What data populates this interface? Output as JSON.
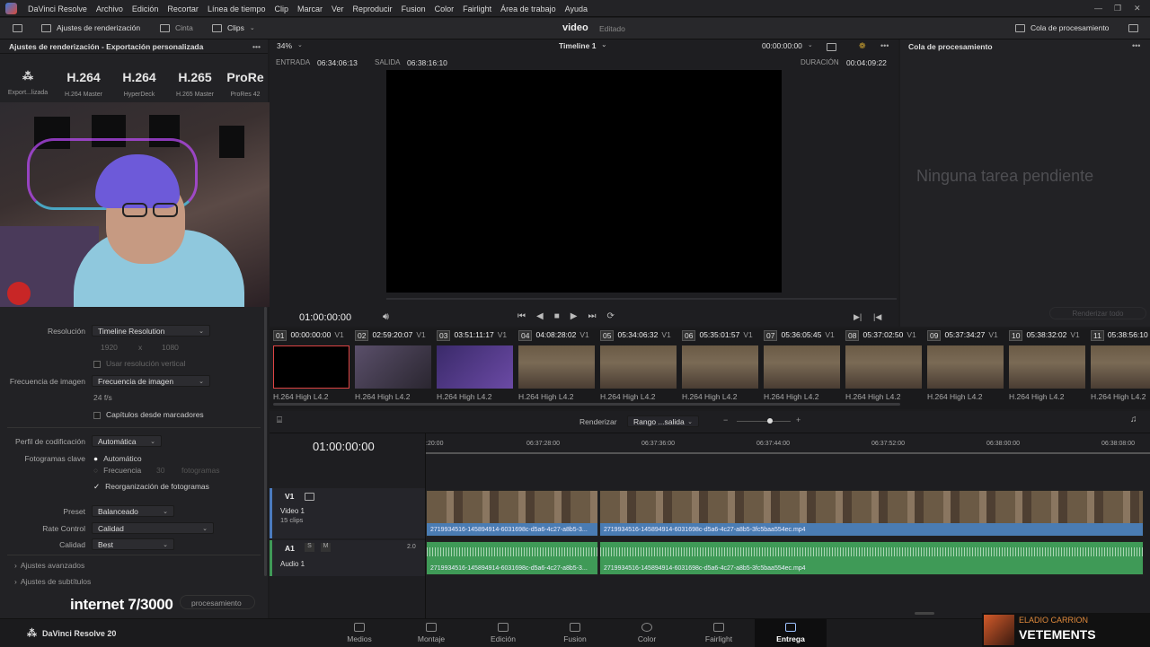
{
  "menubar": {
    "app": "DaVinci Resolve",
    "items": [
      "Archivo",
      "Edición",
      "Recortar",
      "Línea de tiempo",
      "Clip",
      "Marcar",
      "Ver",
      "Reproducir",
      "Fusion",
      "Color",
      "Fairlight",
      "Área de trabajo",
      "Ayuda"
    ]
  },
  "toolbar": {
    "render_settings": "Ajustes de renderización",
    "tape": "Cinta",
    "clips": "Clips",
    "project": "video",
    "state": "Editado",
    "queue_button": "Cola de procesamiento"
  },
  "left": {
    "title": "Ajustes de renderización - Exportación personalizada",
    "presets": [
      {
        "big": "",
        "small": "Export...lizada"
      },
      {
        "big": "H.264",
        "small": "H.264 Master"
      },
      {
        "big": "H.264",
        "small": "HyperDeck"
      },
      {
        "big": "H.265",
        "small": "H.265 Master"
      },
      {
        "big": "ProRe",
        "small": "ProRes 42"
      }
    ],
    "resolution_label": "Resolución",
    "resolution_value": "Timeline Resolution",
    "res_w": "1920",
    "res_x": "x",
    "res_h": "1080",
    "vertical_label": "Usar resolución vertical",
    "framerate_label": "Frecuencia de imagen",
    "framerate_value": "Frecuencia de imagen",
    "fps": "24 f/s",
    "chapters_label": "Capítulos desde marcadores",
    "profile_label": "Perfil de codificación",
    "profile_value": "Automática",
    "keyframes_label": "Fotogramas clave",
    "kf_auto": "Automático",
    "kf_freq": "Frecuencia",
    "kf_freq_val": "30",
    "kf_frames": "fotogramas",
    "reorder_label": "Reorganización de fotogramas",
    "preset_label": "Preset",
    "preset_value": "Balanceado",
    "rate_label": "Rate Control",
    "rate_value": "Calidad",
    "quality_label": "Calidad",
    "quality_value": "Best",
    "advanced": "Ajustes avanzados",
    "subtitles": "Ajustes de subtítulos",
    "add_queue": "procesamiento",
    "overlay": "internet 7/3000"
  },
  "viewer": {
    "zoom": "34%",
    "timeline_name": "Timeline 1",
    "timecode_top": "00:00:00:00",
    "in_label": "ENTRADA",
    "in_value": "06:34:06:13",
    "out_label": "SALIDA",
    "out_value": "06:38:16:10",
    "dur_label": "DURACIÓN",
    "dur_value": "00:04:09:22",
    "current": "01:00:00:00"
  },
  "queue": {
    "title": "Cola de procesamiento",
    "empty": "Ninguna tarea pendiente",
    "render_all": "Renderizar todo"
  },
  "clips": [
    {
      "num": "01",
      "tc": "00:00:00:00",
      "track": "V1",
      "codec": "H.264 High L4.2"
    },
    {
      "num": "02",
      "tc": "02:59:20:07",
      "track": "V1",
      "codec": "H.264 High L4.2"
    },
    {
      "num": "03",
      "tc": "03:51:11:17",
      "track": "V1",
      "codec": "H.264 High L4.2"
    },
    {
      "num": "04",
      "tc": "04:08:28:02",
      "track": "V1",
      "codec": "H.264 High L4.2"
    },
    {
      "num": "05",
      "tc": "05:34:06:32",
      "track": "V1",
      "codec": "H.264 High L4.2"
    },
    {
      "num": "06",
      "tc": "05:35:01:57",
      "track": "V1",
      "codec": "H.264 High L4.2"
    },
    {
      "num": "07",
      "tc": "05:36:05:45",
      "track": "V1",
      "codec": "H.264 High L4.2"
    },
    {
      "num": "08",
      "tc": "05:37:02:50",
      "track": "V1",
      "codec": "H.264 High L4.2"
    },
    {
      "num": "09",
      "tc": "05:37:34:27",
      "track": "V1",
      "codec": "H.264 High L4.2"
    },
    {
      "num": "10",
      "tc": "05:38:32:02",
      "track": "V1",
      "codec": "H.264 High L4.2"
    },
    {
      "num": "11",
      "tc": "05:38:56:10",
      "track": "V1",
      "codec": "H.264 High L4.2"
    }
  ],
  "timeline": {
    "render_label": "Renderizar",
    "range_value": "Rango ...salida",
    "timecode": "01:00:00:00",
    "ruler": [
      ":20:00",
      "06:37:28:00",
      "06:37:36:00",
      "06:37:44:00",
      "06:37:52:00",
      "06:38:00:00",
      "06:38:08:00"
    ],
    "v1": "V1",
    "video_name": "Video 1",
    "video_count": "15 clips",
    "a1": "A1",
    "audio_name": "Audio 1",
    "a_s": "S",
    "a_m": "M",
    "a_level": "2.0",
    "clip_a": "2719934516-145894914-6031698c-d5a6-4c27-a8b5-3...",
    "clip_b": "2719934516-145894914-6031698c-d5a6-4c27-a8b5-3fc5baa554ec.mp4",
    "aclip_a": "2719934516-145894914-6031698c-d5a6-4c27-a8b5-3...",
    "aclip_b": "2719934516-145894914-6031698c-d5a6-4c27-a8b5-3fc5baa554ec.mp4"
  },
  "bottom": {
    "brand": "DaVinci Resolve 20",
    "tabs": [
      "Medios",
      "Montaje",
      "Edición",
      "Fusion",
      "Color",
      "Fairlight",
      "Entrega"
    ],
    "active_tab": "Entrega",
    "song_artist": "ELADIO CARRION",
    "song_title": "VETEMENTS"
  }
}
